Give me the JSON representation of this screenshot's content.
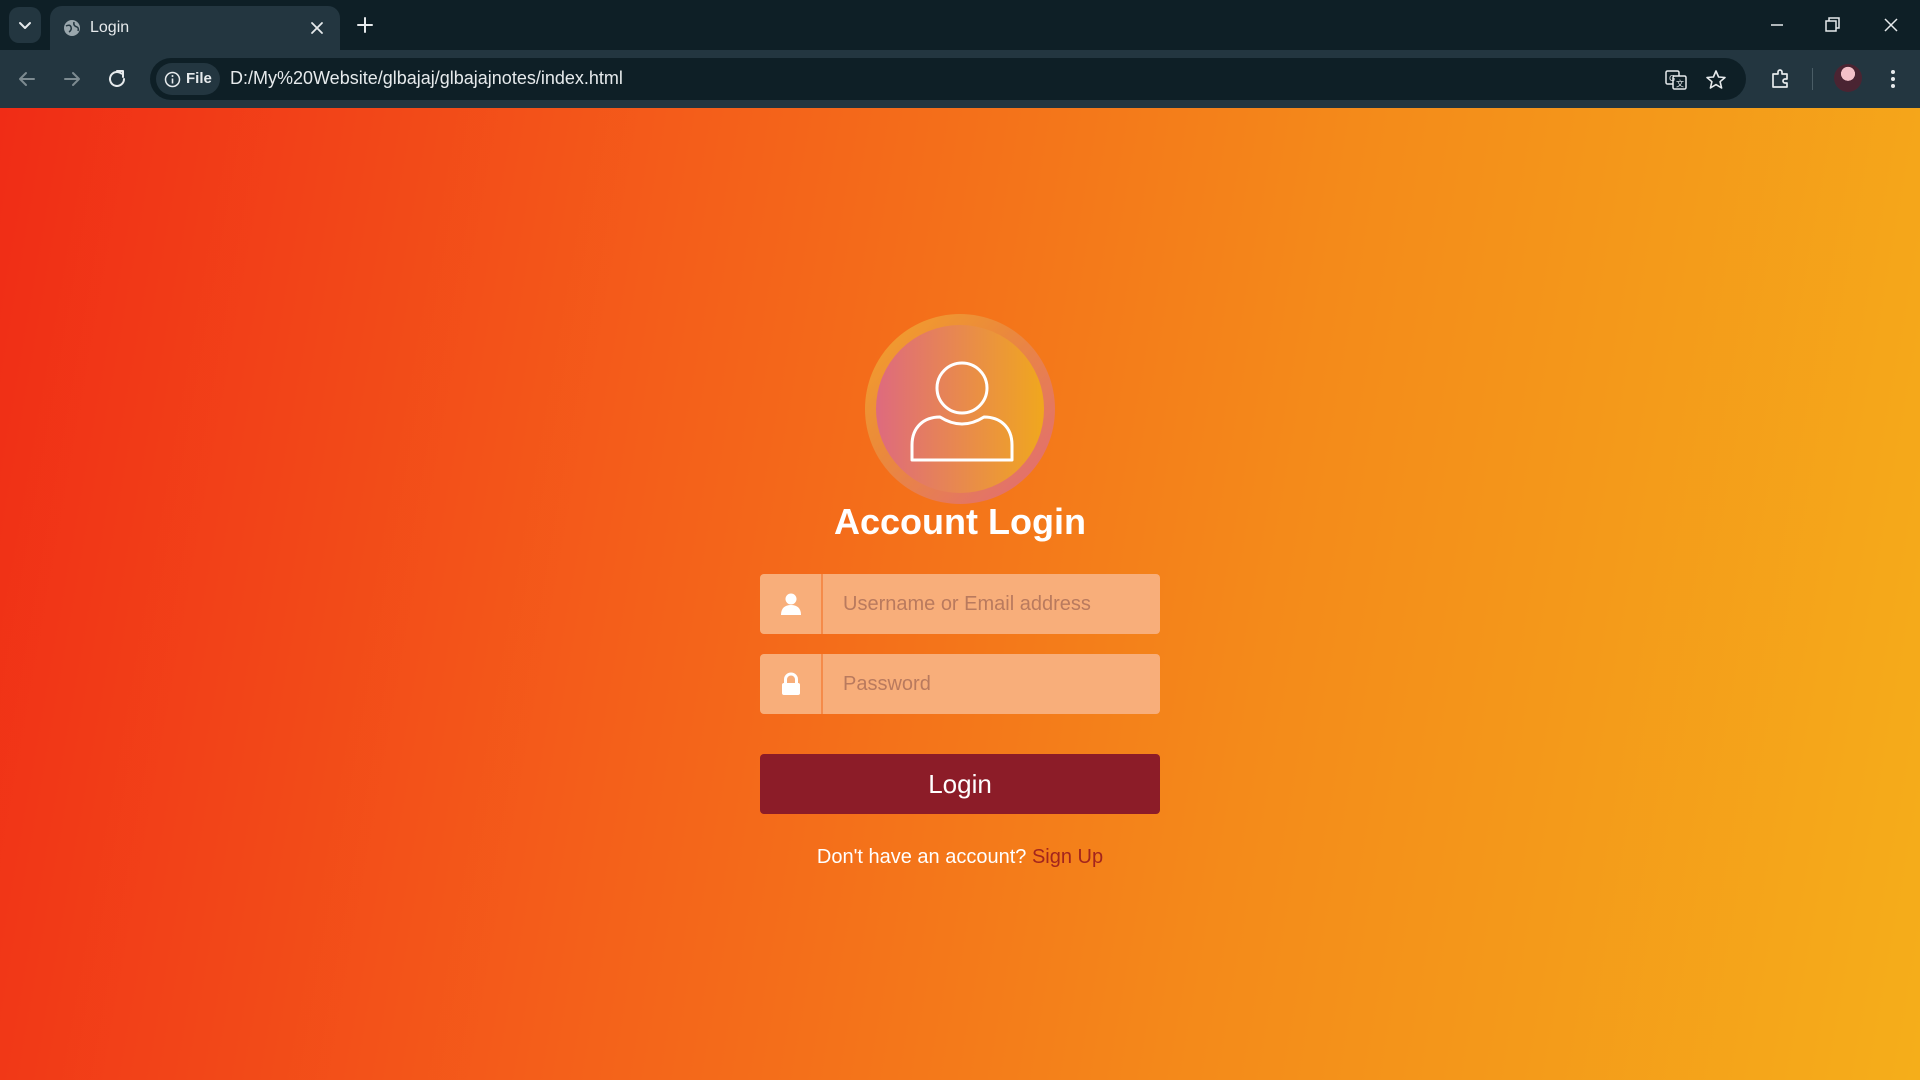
{
  "browser": {
    "tab": {
      "title": "Login"
    },
    "address_bar": {
      "scheme_label": "File",
      "url": "D:/My%20Website/glbajaj/glbajajnotes/index.html"
    },
    "icons": {
      "tab_list": "chevron-down-icon",
      "favicon": "globe-icon",
      "close_tab": "close-icon",
      "new_tab": "plus-icon",
      "back": "arrow-left-icon",
      "forward": "arrow-right-icon",
      "reload": "reload-icon",
      "site_info": "info-icon",
      "translate": "translate-icon",
      "bookmark": "star-icon",
      "extensions": "puzzle-icon",
      "profile": "avatar",
      "menu": "kebab-menu-icon",
      "minimize": "minimize-icon",
      "maximize": "restore-icon",
      "close_window": "close-icon"
    },
    "colors": {
      "frame": "#0e1f26",
      "toolbar": "#233640"
    }
  },
  "login": {
    "title": "Account Login",
    "username": {
      "placeholder": "Username or Email address",
      "value": "",
      "icon": "user-icon"
    },
    "password": {
      "placeholder": "Password",
      "value": "",
      "icon": "lock-icon"
    },
    "submit_label": "Login",
    "signup_prompt": "Don't have an account?",
    "signup_link": "Sign Up",
    "avatar_icon": "user-outline-icon"
  },
  "colors": {
    "background_gradient": [
      "#f02c16",
      "#f4601a",
      "#f48a1a",
      "#f5ae1a"
    ],
    "button": "#8c1c28",
    "input_background": "#f8ae7a",
    "link": "#a3251d",
    "text": "#ffffff"
  }
}
